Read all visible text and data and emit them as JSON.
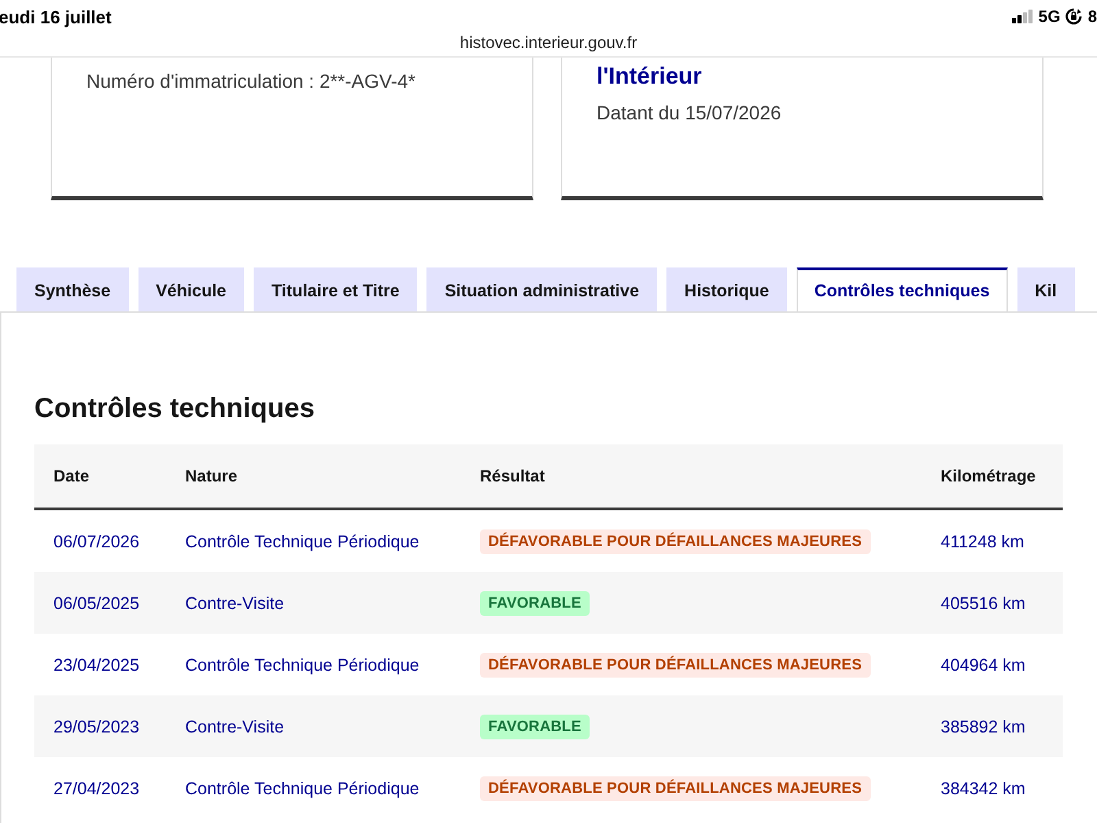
{
  "status_bar": {
    "date": "eudi 16 juillet",
    "network": "5G",
    "battery": "8"
  },
  "address_bar": {
    "url": "histovec.interieur.gouv.fr"
  },
  "cards": [
    {
      "lines": [
        {
          "kind": "text",
          "text": "Numéro d'immatriculation : 2**-AGV-4*"
        }
      ]
    },
    {
      "lines": [
        {
          "kind": "title",
          "text": "l'Intérieur"
        },
        {
          "kind": "text",
          "text": "Datant du 15/07/2026"
        }
      ]
    }
  ],
  "tabs": [
    {
      "label": "Synthèse",
      "selected": false
    },
    {
      "label": "Véhicule",
      "selected": false
    },
    {
      "label": "Titulaire et Titre",
      "selected": false
    },
    {
      "label": "Situation administrative",
      "selected": false
    },
    {
      "label": "Historique",
      "selected": false
    },
    {
      "label": "Contrôles techniques",
      "selected": true
    },
    {
      "label": "Kil",
      "selected": false
    }
  ],
  "section": {
    "title": "Contrôles techniques",
    "table": {
      "columns": [
        "Date",
        "Nature",
        "Résultat",
        "Kilométrage"
      ],
      "rows": [
        {
          "date": "06/07/2026",
          "nature": "Contrôle Technique Périodique",
          "result": {
            "kind": "unfavorable",
            "text": "DÉFAVORABLE POUR DÉFAILLANCES MAJEURES"
          },
          "mileage": "411248 km"
        },
        {
          "date": "06/05/2025",
          "nature": "Contre-Visite",
          "result": {
            "kind": "favorable",
            "text": "FAVORABLE"
          },
          "mileage": "405516 km"
        },
        {
          "date": "23/04/2025",
          "nature": "Contrôle Technique Périodique",
          "result": {
            "kind": "unfavorable",
            "text": "DÉFAVORABLE POUR DÉFAILLANCES MAJEURES"
          },
          "mileage": "404964 km"
        },
        {
          "date": "29/05/2023",
          "nature": "Contre-Visite",
          "result": {
            "kind": "favorable",
            "text": "FAVORABLE"
          },
          "mileage": "385892 km"
        },
        {
          "date": "27/04/2023",
          "nature": "Contrôle Technique Périodique",
          "result": {
            "kind": "unfavorable",
            "text": "DÉFAVORABLE POUR DÉFAILLANCES MAJEURES"
          },
          "mileage": "384342 km"
        }
      ]
    }
  }
}
